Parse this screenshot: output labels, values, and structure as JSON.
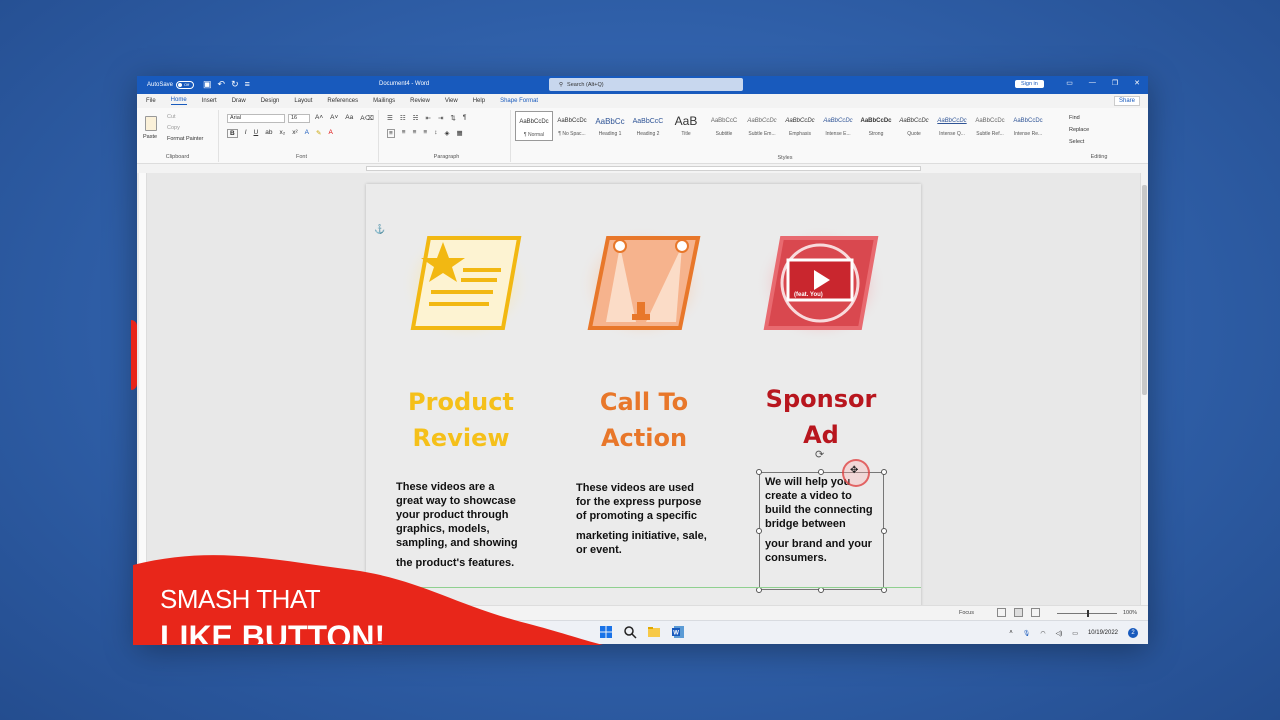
{
  "titlebar": {
    "autosave_label": "AutoSave",
    "autosave_state": "Off",
    "doc_title": "Document4 - Word",
    "search_placeholder": "Search (Alt+Q)",
    "signin": "Sign in"
  },
  "tabs": [
    "File",
    "Home",
    "Insert",
    "Draw",
    "Design",
    "Layout",
    "References",
    "Mailings",
    "Review",
    "View",
    "Help",
    "Shape Format"
  ],
  "active_tab": "Home",
  "share_label": "Share",
  "ribbon": {
    "clipboard": {
      "paste": "Paste",
      "cut": "Cut",
      "copy": "Copy",
      "format_painter": "Format Painter",
      "label": "Clipboard"
    },
    "font": {
      "name": "Arial",
      "size": "16",
      "label": "Font"
    },
    "paragraph": {
      "label": "Paragraph"
    },
    "styles": {
      "label": "Styles",
      "items": [
        {
          "preview": "AaBbCcDc",
          "name": "¶ Normal"
        },
        {
          "preview": "AaBbCcDc",
          "name": "¶ No Spac..."
        },
        {
          "preview": "AaBbCc",
          "name": "Heading 1"
        },
        {
          "preview": "AaBbCcC",
          "name": "Heading 2"
        },
        {
          "preview": "AaB",
          "name": "Title"
        },
        {
          "preview": "AaBbCcC",
          "name": "Subtitle"
        },
        {
          "preview": "AaBbCcDc",
          "name": "Subtle Em..."
        },
        {
          "preview": "AaBbCcDc",
          "name": "Emphasis"
        },
        {
          "preview": "AaBbCcDc",
          "name": "Intense E..."
        },
        {
          "preview": "AaBbCcDc",
          "name": "Strong"
        },
        {
          "preview": "AaBbCcDc",
          "name": "Quote"
        },
        {
          "preview": "AaBbCcDc",
          "name": "Intense Q..."
        },
        {
          "preview": "AaBbCcDc",
          "name": "Subtle Ref..."
        },
        {
          "preview": "AaBbCcDc",
          "name": "Intense Re..."
        }
      ]
    },
    "editing": {
      "find": "Find",
      "replace": "Replace",
      "select": "Select",
      "label": "Editing"
    }
  },
  "document": {
    "cards": [
      {
        "heading_line1": "Product",
        "heading_line2": "Review",
        "color": "#f5c01a",
        "body": [
          "These videos are a",
          "great way to showcase",
          "your product through",
          "graphics, models,",
          "sampling, and showing",
          "the product's features."
        ]
      },
      {
        "heading_line1": "Call To",
        "heading_line2": "Action",
        "color": "#e8772a",
        "body": [
          "These videos are used",
          "for the express purpose",
          "of promoting a specific",
          "marketing initiative, sale,",
          "or event."
        ]
      },
      {
        "heading_line1": "Sponsor",
        "heading_line2": "Ad",
        "color": "#b8161e",
        "icon_caption": "(feat. You)",
        "body": [
          "We will help you",
          "create a video to",
          "build the connecting",
          "bridge between",
          "your brand and your",
          "consumers."
        ]
      }
    ]
  },
  "statusbar": {
    "focus": "Focus",
    "zoom": "100%"
  },
  "taskbar": {
    "date": "10/19/2022",
    "notifications": "2"
  },
  "overlay": {
    "line1": "SMASH THAT",
    "line2": "LIKE BUTTON!",
    "color": "#e8261a"
  }
}
